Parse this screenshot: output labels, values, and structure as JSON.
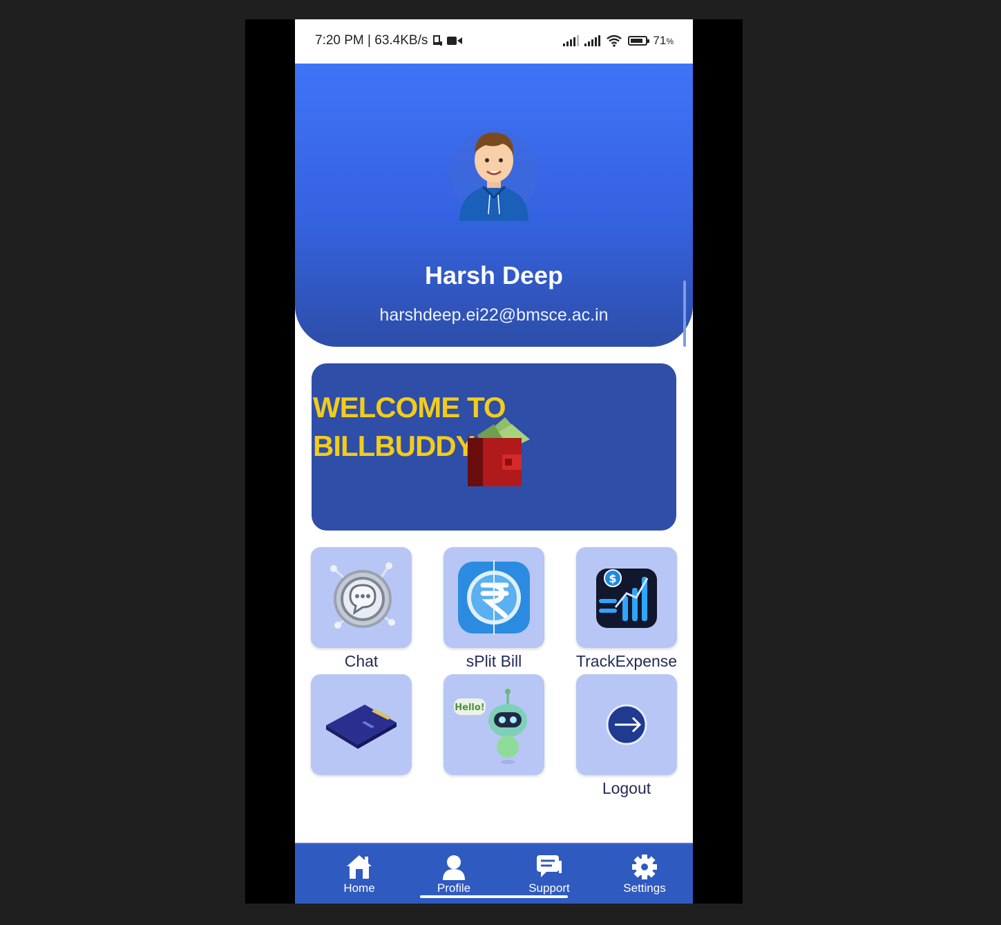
{
  "status_bar": {
    "time_speed": "7:20 PM | 63.4KB/s",
    "battery": "71",
    "battery_unit": "%"
  },
  "profile": {
    "name": "Harsh Deep",
    "email": "harshdeep.ei22@bmsce.ac.in"
  },
  "banner": {
    "line1": "WELCOME TO",
    "line2": "BILLBUDDY"
  },
  "features": [
    {
      "label": "Chat",
      "icon": "chat-icon"
    },
    {
      "label": "sPlit Bill",
      "icon": "rupee-split-icon"
    },
    {
      "label": "TrackExpense",
      "icon": "expense-chart-icon"
    },
    {
      "label": "",
      "icon": "card-wallet-icon"
    },
    {
      "label": "",
      "icon": "chatbot-icon",
      "bubble": "Hello!"
    },
    {
      "label": "Logout",
      "icon": "logout-arrow-icon"
    }
  ],
  "nav": {
    "items": [
      {
        "label": "Home",
        "icon": "home-icon"
      },
      {
        "label": "Profile",
        "icon": "profile-icon"
      },
      {
        "label": "Support",
        "icon": "support-chat-icon"
      },
      {
        "label": "Settings",
        "icon": "gear-icon"
      }
    ],
    "active": "Profile"
  },
  "colors": {
    "header_top": "#3f74f7",
    "header_bottom": "#2d4ea8",
    "banner": "#2f4ea8",
    "banner_text": "#f2cc1a",
    "tile": "#b7c6f5",
    "nav": "#2f5ac0"
  }
}
